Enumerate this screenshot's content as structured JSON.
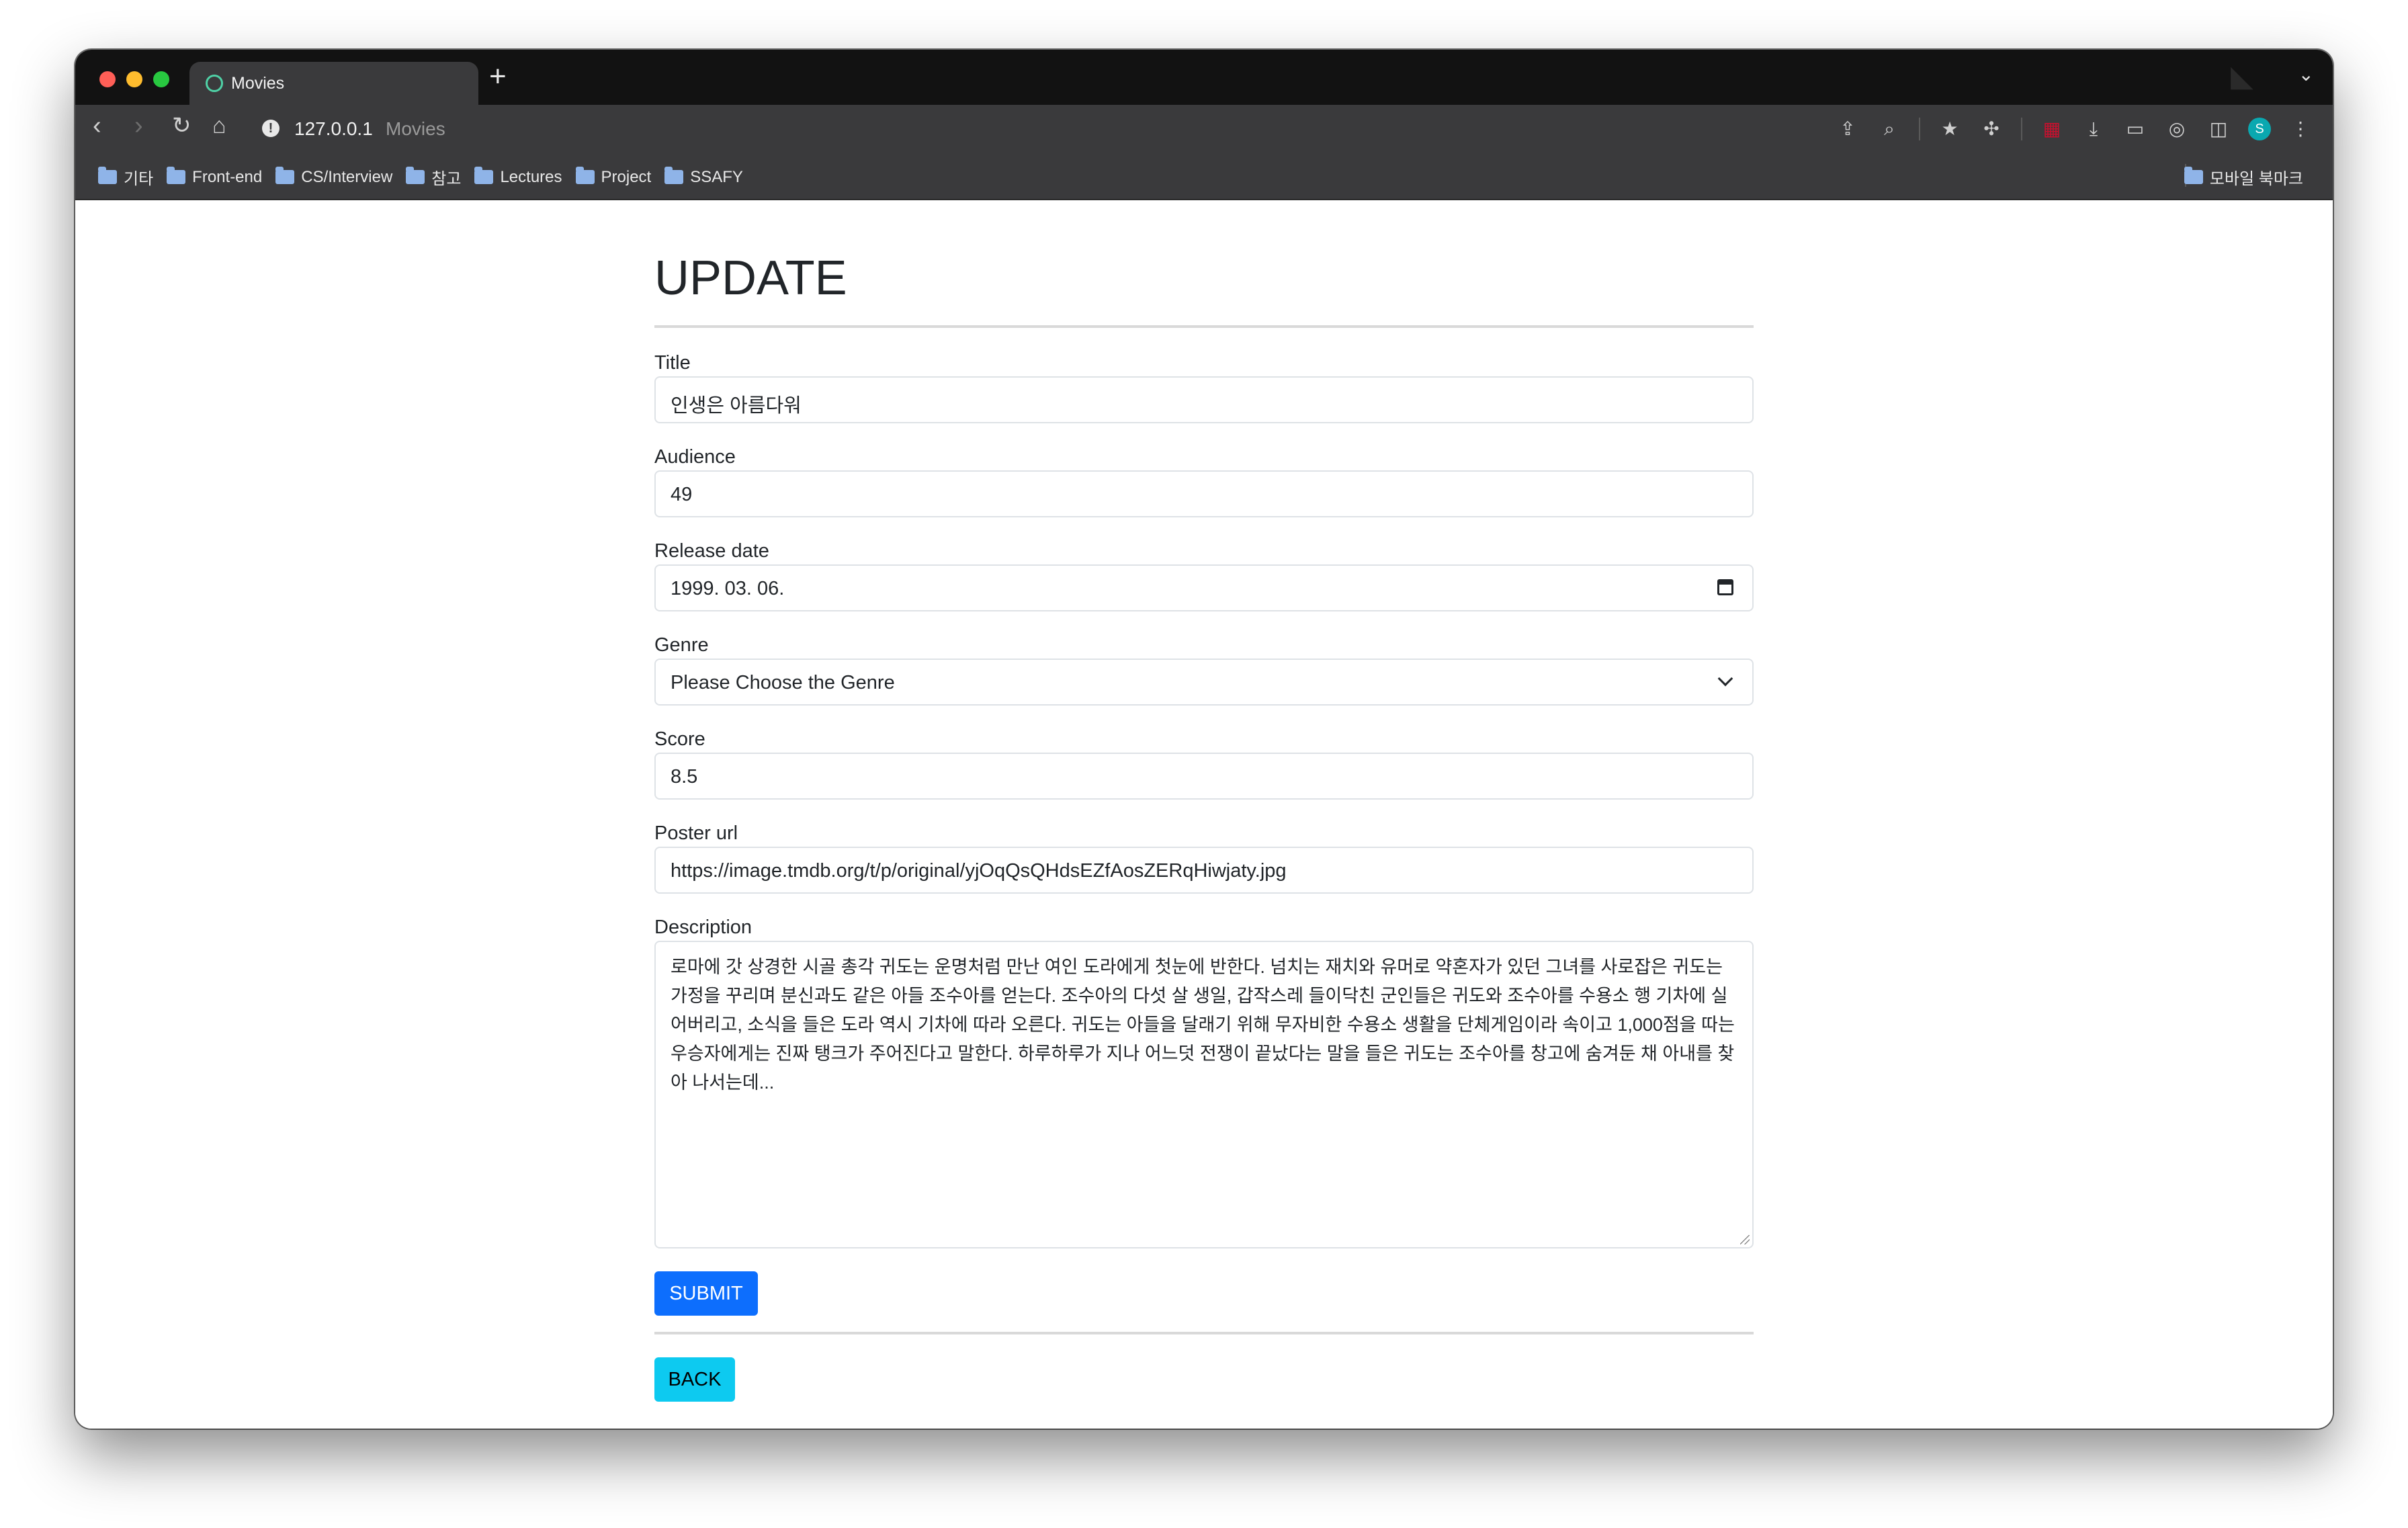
{
  "browser": {
    "tab_title": "Movies",
    "url_host": "127.0.0.1",
    "url_title": "Movies",
    "avatar_initial": "S",
    "bookmarks": [
      "기타",
      "Front-end",
      "CS/Interview",
      "참고",
      "Lectures",
      "Project",
      "SSAFY"
    ],
    "mobile_bookmarks": "모바일 북마크",
    "icons": {
      "back": "back-arrow-icon",
      "forward": "forward-arrow-icon",
      "reload": "reload-icon",
      "home": "home-icon",
      "new_tab": "plus-icon"
    }
  },
  "form": {
    "heading": "UPDATE",
    "title_label": "Title",
    "title_value": "인생은 아름다워",
    "audience_label": "Audience",
    "audience_value": "49",
    "release_label": "Release date",
    "release_value": "1999. 03. 06.",
    "genre_label": "Genre",
    "genre_value": "Please Choose the Genre",
    "score_label": "Score",
    "score_value": "8.5",
    "poster_label": "Poster url",
    "poster_value": "https://image.tmdb.org/t/p/original/yjOqQsQHdsEZfAosZERqHiwjaty.jpg",
    "description_label": "Description",
    "description_value": "로마에 갓 상경한 시골 총각 귀도는 운명처럼 만난 여인 도라에게 첫눈에 반한다. 넘치는 재치와 유머로 약혼자가 있던 그녀를 사로잡은 귀도는 가정을 꾸리며 분신과도 같은 아들 조수아를 얻는다. 조수아의 다섯 살 생일, 갑작스레 들이닥친 군인들은 귀도와 조수아를 수용소 행 기차에 실어버리고, 소식을 들은 도라 역시 기차에 따라 오른다. 귀도는 아들을 달래기 위해 무자비한 수용소 생활을 단체게임이라 속이고 1,000점을 따는 우승자에게는 진짜 탱크가 주어진다고 말한다. 하루하루가 지나 어느덧 전쟁이 끝났다는 말을 들은 귀도는 조수아를 창고에 숨겨둔 채 아내를 찾아 나서는데...",
    "submit_label": "SUBMIT",
    "back_label": "BACK"
  },
  "colors": {
    "submit_bg": "#0d6efd",
    "back_bg": "#0dcaf0",
    "chrome_bg": "#3a3a3c",
    "tabstrip_bg": "#121212"
  }
}
